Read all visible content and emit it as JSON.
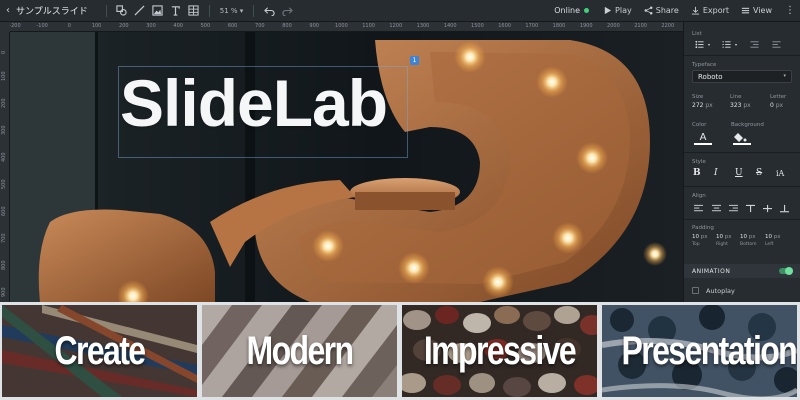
{
  "toolbar": {
    "back_glyph": "‹",
    "title": "サンプルスライド",
    "zoom": "51 % ▾",
    "status": "Online",
    "status_color": "#3fd27a",
    "actions": {
      "play": "Play",
      "share": "Share",
      "export": "Export",
      "view": "View"
    },
    "icons": [
      "shapes-icon",
      "line-icon",
      "image-icon",
      "text-icon",
      "table-icon",
      "undo-icon",
      "redo-icon"
    ]
  },
  "ruler": {
    "h_ticks": [
      "-200",
      "-100",
      "0",
      "100",
      "200",
      "300",
      "400",
      "500",
      "600",
      "700",
      "800",
      "900",
      "1000",
      "1100",
      "1200",
      "1300",
      "1400",
      "1500",
      "1600",
      "1700",
      "1800",
      "1900",
      "2000",
      "2100",
      "2200"
    ],
    "v_ticks": [
      "0",
      "100",
      "200",
      "300",
      "400",
      "500",
      "600",
      "700",
      "800",
      "900"
    ]
  },
  "slide": {
    "title": "SlideLab",
    "badge": "1"
  },
  "panel": {
    "list_label": "List",
    "typeface_label": "Typeface",
    "typeface_value": "Roboto",
    "size_label": "Size",
    "size_value": "272",
    "line_label": "Line",
    "line_value": "323",
    "letter_label": "Letter",
    "letter_value": "0",
    "unit_px": "px",
    "color_label": "Color",
    "background_label": "Background",
    "style_label": "Style",
    "style_buttons": [
      "B",
      "I",
      "U",
      "S",
      "iA"
    ],
    "align_label": "Align",
    "padding_label": "Padding",
    "padding": [
      {
        "value": "10",
        "side": "Top"
      },
      {
        "value": "10",
        "side": "Right"
      },
      {
        "value": "10",
        "side": "Bottom"
      },
      {
        "value": "10",
        "side": "Left"
      }
    ],
    "animation_title": "ANIMATION",
    "autoplay_label": "Autoplay"
  },
  "tiles": [
    "Create",
    "Modern",
    "Impressive",
    "Presentations"
  ]
}
